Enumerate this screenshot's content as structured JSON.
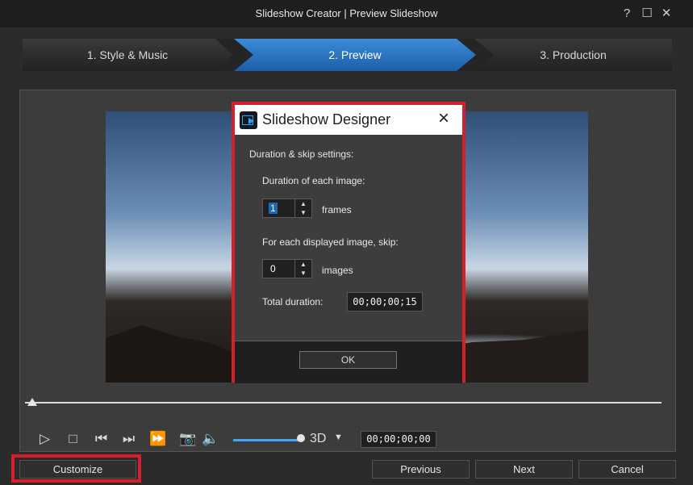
{
  "window": {
    "title": "Slideshow Creator | Preview Slideshow"
  },
  "steps": [
    {
      "label": "1. Style & Music"
    },
    {
      "label": "2. Preview"
    },
    {
      "label": "3. Production"
    }
  ],
  "dialog": {
    "title": "Slideshow Designer",
    "section": "Duration & skip settings:",
    "duration_label": "Duration of each image:",
    "duration_value": "1",
    "duration_unit": "frames",
    "skip_label": "For each displayed image, skip:",
    "skip_value": "0",
    "skip_unit": "images",
    "total_label": "Total duration:",
    "total_value": "00;00;00;15",
    "ok": "OK"
  },
  "player": {
    "three_d": "3D",
    "timecode": "00;00;00;00"
  },
  "buttons": {
    "customize": "Customize",
    "previous": "Previous",
    "next": "Next",
    "cancel": "Cancel"
  },
  "colors": {
    "accent": "#2b7fdc",
    "highlight": "#d61f2c"
  }
}
